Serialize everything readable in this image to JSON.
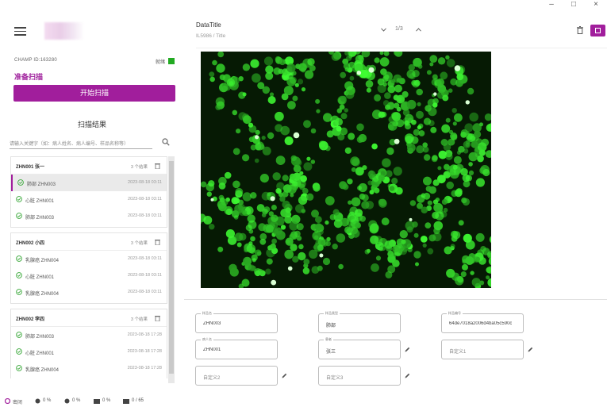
{
  "window": {
    "minimize": "–",
    "maximize": "□",
    "close": "×"
  },
  "sidebar": {
    "device_id": "CHAMP ID:163280",
    "status_label": "就绪",
    "ready_label": "准备扫描",
    "start_button": "开始扫描",
    "results_title": "扫描结果",
    "search_placeholder": "请输入关键字（如：病人姓名、病人编号、样品名称等）",
    "groups": [
      {
        "name": "ZHN001 张一",
        "count": "3 个结果",
        "rows": [
          {
            "name": "肺部 ZHN003",
            "time": "2023-08-18 03:11"
          },
          {
            "name": "心脏 ZHN001",
            "time": "2023-08-18 03:11"
          },
          {
            "name": "肺部 ZHN003",
            "time": "2023-08-18 03:11"
          }
        ]
      },
      {
        "name": "ZHN002 小四",
        "count": "3 个结果",
        "rows": [
          {
            "name": "乳腺癌 ZHN004",
            "time": "2023-08-18 03:11"
          },
          {
            "name": "心脏 ZHN001",
            "time": "2023-08-18 03:11"
          },
          {
            "name": "乳腺癌 ZHN004",
            "time": "2023-08-18 03:11"
          }
        ]
      },
      {
        "name": "ZHN002 李四",
        "count": "3 个结果",
        "rows": [
          {
            "name": "肺部 ZHN003",
            "time": "2023-08-18 17:28"
          },
          {
            "name": "心脏 ZHN001",
            "time": "2023-08-18 17:28"
          },
          {
            "name": "乳腺癌 ZHN004",
            "time": "2023-08-18 17:28"
          }
        ]
      }
    ]
  },
  "statusbar": {
    "app_label": "密闭",
    "cpu": "0 %",
    "mem": "0 %",
    "net": "0 %",
    "disk": "0 / 65"
  },
  "main": {
    "title": "DataTitle",
    "subtitle": "IL5986 / Title",
    "pager": "1/3",
    "fields": [
      {
        "label": "样品名",
        "value": "ZHN003"
      },
      {
        "label": "样品类型",
        "value": "肺部"
      },
      {
        "label": "样品编号",
        "value": "64de7018a2006d4ba05c590c"
      },
      {
        "label": "病人名",
        "value": "ZHN001"
      },
      {
        "label": "患者",
        "value": "张三"
      },
      {
        "label": "",
        "value": "自定义1"
      },
      {
        "label": "",
        "value": "自定义2"
      },
      {
        "label": "",
        "value": "自定义3"
      }
    ]
  },
  "colors": {
    "accent": "#a11e9c",
    "status_ok": "#22aa22",
    "fluorescence": "#3de03a"
  }
}
